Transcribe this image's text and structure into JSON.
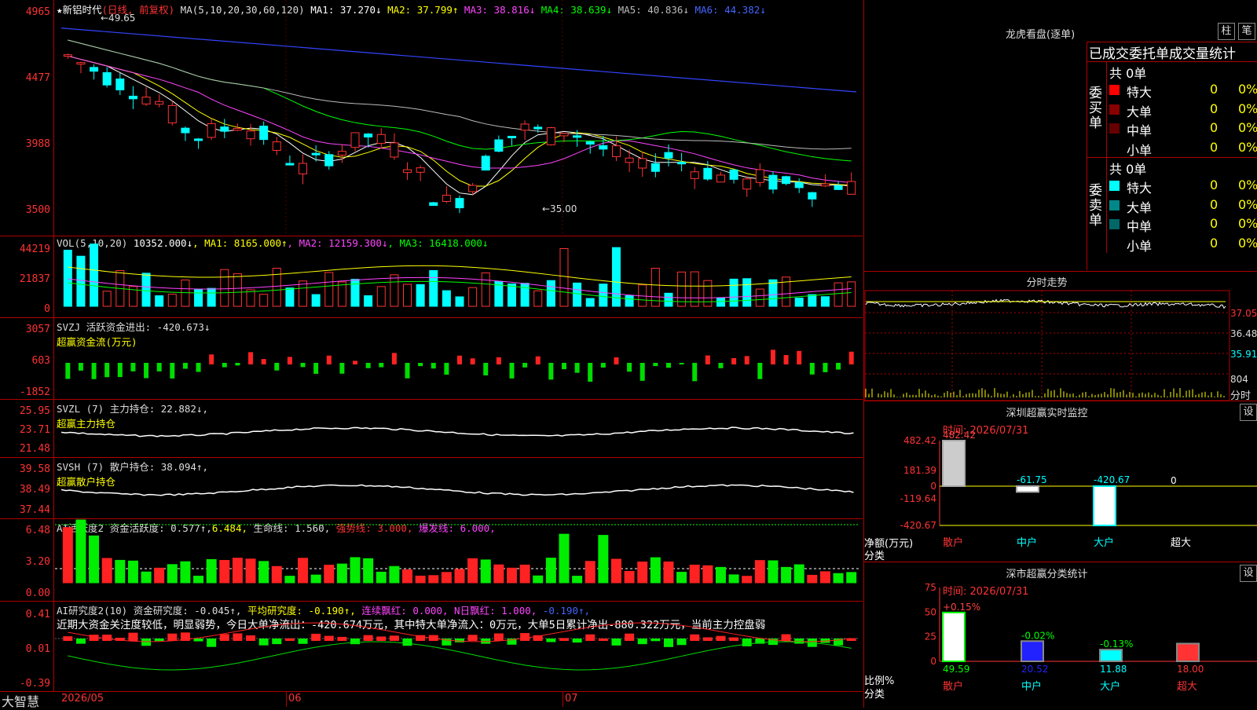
{
  "stock": {
    "name": "★新铝时代",
    "mode": "(日线, 前复权)",
    "ma_label": "MA(5,10,20,30,60,120)",
    "ma": [
      {
        "k": "MA1:",
        "v": "37.270↓",
        "c": "#ffffff"
      },
      {
        "k": "MA2:",
        "v": "37.799↑",
        "c": "#ffff00"
      },
      {
        "k": "MA3:",
        "v": "38.816↓",
        "c": "#ff44ff"
      },
      {
        "k": "MA4:",
        "v": "38.639↓",
        "c": "#00ff00"
      },
      {
        "k": "MA5:",
        "v": "40.836↓",
        "c": "#bbbbbb"
      },
      {
        "k": "MA6:",
        "v": "44.382↓",
        "c": "#4466ff"
      }
    ],
    "high_label": "49.65",
    "low_label": "35.00",
    "y_ticks": [
      "4965",
      "4477",
      "3988",
      "3500"
    ]
  },
  "vol": {
    "label": "VOL(5,10,20)",
    "val": "10352.000↓",
    "ma": [
      {
        "t": "MA1: 8165.000↑",
        "c": "#ffff00"
      },
      {
        "t": "MA2: 12159.300↓",
        "c": "#ff44ff"
      },
      {
        "t": "MA3: 16418.000↓",
        "c": "#00ff00"
      }
    ],
    "y_ticks": [
      "44219",
      "21837",
      "0"
    ]
  },
  "svzj": {
    "label": "SVZJ  活跃资金进出: -420.673↓",
    "sub": "超赢资金流(万元)",
    "y_ticks": [
      "3057",
      "603",
      "-1852"
    ]
  },
  "svzl": {
    "label": "SVZL (7) 主力持仓: 22.882↓,",
    "sub": "超赢主力持仓",
    "y_ticks": [
      "25.95",
      "23.71",
      "21.48"
    ]
  },
  "svsh": {
    "label": "SVSH (7) 散户持仓: 38.094↑,",
    "sub": "超赢散户持仓",
    "y_ticks": [
      "39.58",
      "38.49",
      "37.44"
    ]
  },
  "ai1": {
    "label": "AI活跃度2 资金活跃度: 0.577↑,",
    "v2": "6.484,",
    "v3": "生命线: 1.560,",
    "v4": "强势线: 3.000,",
    "v5": "爆发线: 6.000,",
    "y_ticks": [
      "6.48",
      "3.20",
      "0.00"
    ]
  },
  "ai2": {
    "label": "AI研究度2(10) 资金研究度: -0.045↑,",
    "v2": "平均研究度: -0.190↑,",
    "v3": "连续飘红: 0.000,",
    "v4": "N日飘红: 1.000,",
    "v5": "-0.190↑,",
    "note": "近期大资金关注度较低，明显弱势，今日大单净流出：-420.674万元，其中特大单净流入：0万元，大单5日累计净出-880.322万元，当前主力控盘弱",
    "y_ticks": [
      "0.41",
      "0.01",
      "-0.39"
    ]
  },
  "xaxis": {
    "brand": "大智慧",
    "labels": [
      "2026/05",
      "06",
      "07"
    ]
  },
  "dragon": {
    "title": "龙虎看盘(逐单)",
    "btn1": "柱",
    "btn2": "笔",
    "head": "已成交委托单成交量统计",
    "buy_label": "委买单",
    "buy_total": "共 0单",
    "sell_label": "委卖单",
    "sell_total": "共 0单",
    "buy": [
      {
        "n": "特大",
        "v": "0",
        "p": "0%",
        "c": "#ff0000"
      },
      {
        "n": "大单",
        "v": "0",
        "p": "0%",
        "c": "#880000"
      },
      {
        "n": "中单",
        "v": "0",
        "p": "0%",
        "c": "#660000"
      },
      {
        "n": "小单",
        "v": "0",
        "p": "0%",
        "c": "#000"
      }
    ],
    "sell": [
      {
        "n": "特大",
        "v": "0",
        "p": "0%",
        "c": "#00ffff"
      },
      {
        "n": "大单",
        "v": "0",
        "p": "0%",
        "c": "#008888"
      },
      {
        "n": "中单",
        "v": "0",
        "p": "0%",
        "c": "#006666"
      },
      {
        "n": "小单",
        "v": "0",
        "p": "0%",
        "c": "#000"
      }
    ]
  },
  "fenshi": {
    "title": "分时走势",
    "y_ticks": [
      "37.05",
      "36.48",
      "35.91"
    ],
    "vol_tick": "804",
    "vol_label": "分时"
  },
  "monitor": {
    "title": "深圳超赢实时监控",
    "btn": "设",
    "time": "时间: 2026/07/31",
    "y_ticks": [
      "482.42",
      "181.39",
      "0",
      "-119.64",
      "-420.67"
    ],
    "ylabel": "净额(万元)",
    "xlabel": "分类",
    "cats": [
      "散户",
      "中户",
      "大户",
      "超大"
    ],
    "values": [
      482.42,
      -61.75,
      -420.67,
      0
    ],
    "labels": [
      "482.42",
      "-61.75",
      "-420.67",
      "0"
    ]
  },
  "classify": {
    "title": "深市超赢分类统计",
    "btn": "设",
    "time": "时间: 2026/07/31",
    "y_ticks": [
      "75",
      "50",
      "25",
      "0"
    ],
    "ylabel": "比例%",
    "xlabel": "分类",
    "cats": [
      "散户",
      "中户",
      "大户",
      "超大"
    ],
    "values": [
      49.59,
      20.52,
      11.88,
      18.0
    ],
    "labels": [
      "49.59",
      "20.52",
      "11.88",
      "18.00"
    ],
    "changes": [
      "+0.15%",
      "-0.02%",
      "-0.13%",
      ""
    ],
    "colors": [
      "#ffffff",
      "#2222ff",
      "#00ffff",
      "#ff3333"
    ]
  }
}
